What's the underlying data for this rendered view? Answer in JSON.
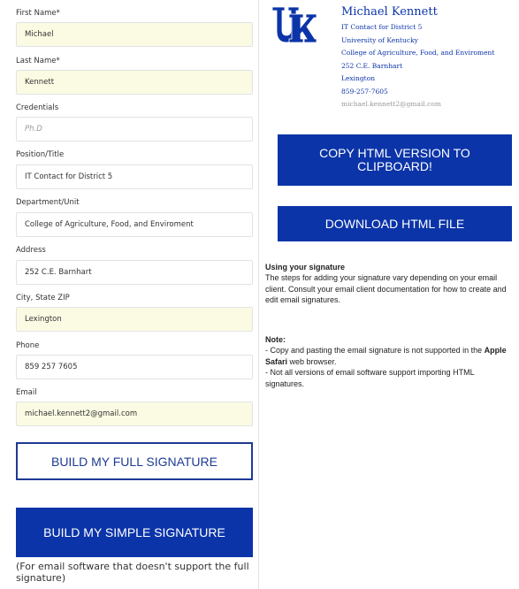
{
  "form": {
    "first_name": {
      "label": "First Name*",
      "value": "Michael"
    },
    "last_name": {
      "label": "Last Name*",
      "value": "Kennett"
    },
    "credentials": {
      "label": "Credentials",
      "placeholder": "Ph.D"
    },
    "position": {
      "label": "Position/Title",
      "value": "IT Contact for District 5"
    },
    "department": {
      "label": "Department/Unit",
      "value": "College of Agriculture, Food, and Enviroment"
    },
    "address": {
      "label": "Address",
      "value": "252 C.E. Barnhart"
    },
    "city": {
      "label": "City, State ZIP",
      "value": "Lexington"
    },
    "phone": {
      "label": "Phone",
      "value": "859 257 7605"
    },
    "email": {
      "label": "Email",
      "value": "michael.kennett2@gmail.com"
    }
  },
  "buttons": {
    "build_full": "BUILD MY FULL SIGNATURE",
    "build_simple": "BUILD MY SIMPLE SIGNATURE",
    "copy_html": "COPY HTML VERSION TO CLIPBOARD!",
    "download_html": "DOWNLOAD HTML FILE"
  },
  "simple_note": "(For email software that doesn't support the full signature)",
  "preview": {
    "logo_icon": "uk-logo",
    "name": "Michael Kennett",
    "title": "IT Contact for District 5",
    "university": "University of Kentucky",
    "department": "College of Agriculture, Food, and Enviroment",
    "address": "252 C.E. Barnhart",
    "city": "Lexington",
    "phone": "859-257-7605",
    "email": "michael.kennett2@gmail.com"
  },
  "info": {
    "using_heading": "Using your signature",
    "using_text": "The steps for adding your signature vary depending on your email client. Consult your email client documentation for how to create and edit email signatures.",
    "note_heading": "Note:",
    "note1_pre": "- Copy and pasting the email signature is not supported in the ",
    "note1_bold": "Apple Safari",
    "note1_post": " web browser.",
    "note2": "- Not all versions of email software support importing HTML signatures."
  },
  "colors": {
    "brand_blue": "#0b34a8",
    "filled_field": "#fbfbe4"
  }
}
